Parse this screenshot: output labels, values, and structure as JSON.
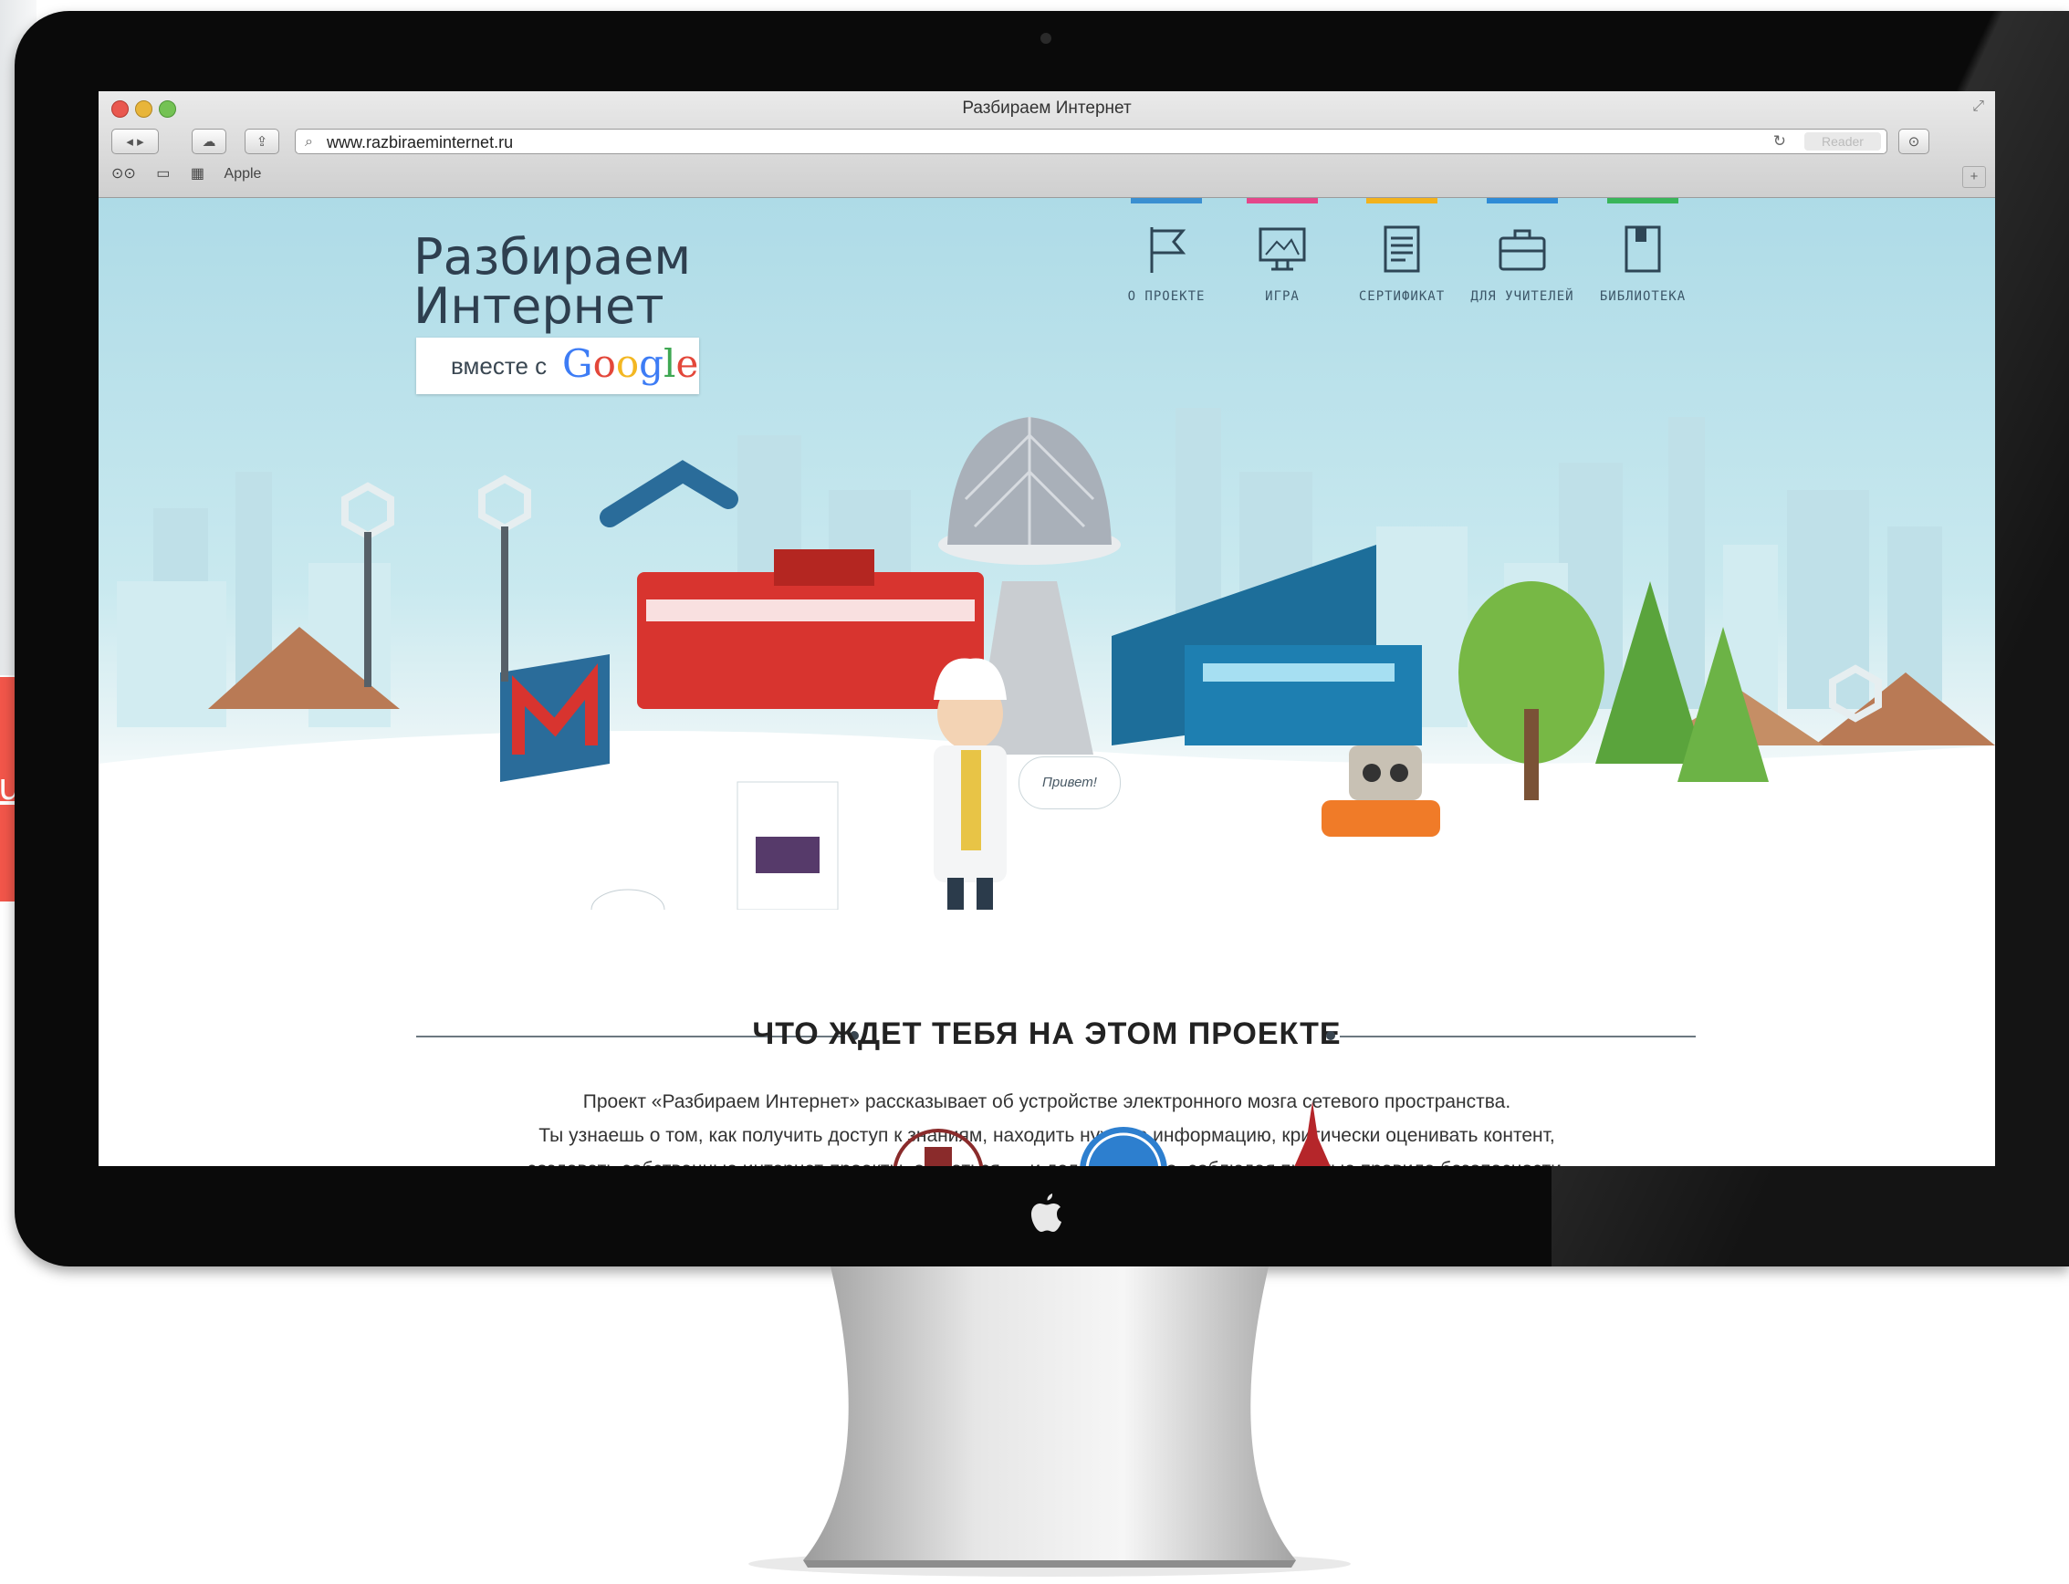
{
  "browser": {
    "window_title": "Разбираем Интернет",
    "url": "www.razbiraeminternet.ru",
    "reader_label": "Reader",
    "bookmark_label": "Apple",
    "tab_plus": "+"
  },
  "site": {
    "logo_line1": "Разбираем",
    "logo_line2": "Интернет",
    "badge_with": "вместе с",
    "badge_google": "Google",
    "nav": [
      {
        "label": "О ПРОЕКТЕ",
        "color": "#3a8fd1",
        "icon": "flag-icon"
      },
      {
        "label": "ИГРА",
        "color": "#e4478a",
        "icon": "monitor-icon"
      },
      {
        "label": "СЕРТИФИКАТ",
        "color": "#f2b21d",
        "icon": "document-icon"
      },
      {
        "label": "ДЛЯ УЧИТЕЛЕЙ",
        "color": "#2f8bd6",
        "icon": "briefcase-icon"
      },
      {
        "label": "БИБЛИОТЕКА",
        "color": "#39b55a",
        "icon": "book-icon"
      }
    ],
    "speech_bubble": "Привет!",
    "section_title": "ЧТО ЖДЕТ ТЕБЯ НА ЭТОМ ПРОЕКТЕ",
    "description": [
      "Проект «Разбираем Интернет» рассказывает об устройстве электронного мозга сетевого пространства.",
      "Ты узнаешь о том, как получить доступ к знаниям, находить нужную информацию, критически оценивать контент,",
      "создавать собственные интернет-проекты, общаться — и делать все это, соблюдая простые правила безопасности."
    ]
  },
  "overlay": {
    "red_block_text": "u",
    "red_color": "#f2564a"
  }
}
